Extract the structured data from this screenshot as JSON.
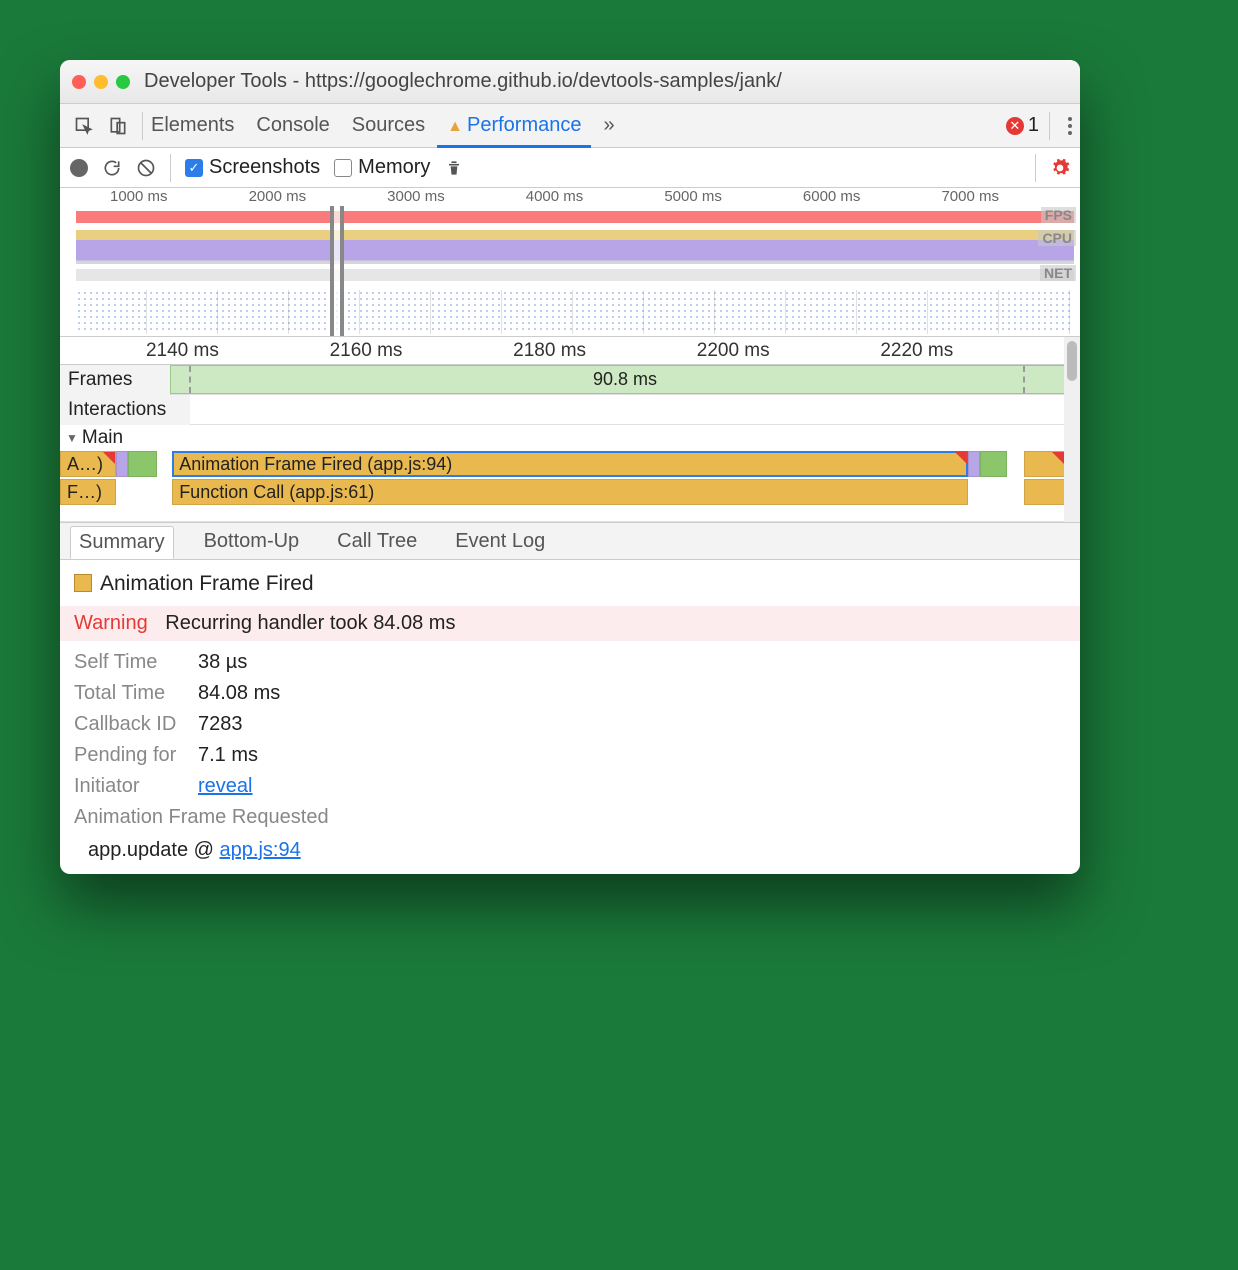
{
  "window": {
    "title": "Developer Tools - https://googlechrome.github.io/devtools-samples/jank/"
  },
  "tabs": {
    "elements": "Elements",
    "console": "Console",
    "sources": "Sources",
    "performance": "Performance",
    "more": "»",
    "errors": "1"
  },
  "toolbar": {
    "screenshots": "Screenshots",
    "memory": "Memory"
  },
  "overview": {
    "ticks": [
      "1000 ms",
      "2000 ms",
      "3000 ms",
      "4000 ms",
      "5000 ms",
      "6000 ms",
      "7000 ms"
    ],
    "labels": {
      "fps": "FPS",
      "cpu": "CPU",
      "net": "NET"
    }
  },
  "detail": {
    "ticks": [
      "2140 ms",
      "2160 ms",
      "2180 ms",
      "2200 ms",
      "2220 ms"
    ]
  },
  "tracks": {
    "frames": "Frames",
    "interactions": "Interactions",
    "main": "Main",
    "frame_dur": "90.8 ms",
    "bar_aff_short": "A…)",
    "bar_fc_short": "F…)",
    "bar_aff": "Animation Frame Fired (app.js:94)",
    "bar_fc": "Function Call (app.js:61)"
  },
  "btabs": {
    "summary": "Summary",
    "bottomup": "Bottom-Up",
    "calltree": "Call Tree",
    "eventlog": "Event Log"
  },
  "summary": {
    "title": "Animation Frame Fired",
    "warning_label": "Warning",
    "warning_text": "Recurring handler took 84.08 ms",
    "self_time_k": "Self Time",
    "self_time_v": "38 µs",
    "total_time_k": "Total Time",
    "total_time_v": "84.08 ms",
    "callback_k": "Callback ID",
    "callback_v": "7283",
    "pending_k": "Pending for",
    "pending_v": "7.1 ms",
    "initiator_k": "Initiator",
    "initiator_v": "reveal",
    "afr": "Animation Frame Requested",
    "stack_text": "app.update @ ",
    "stack_link": "app.js:94"
  }
}
